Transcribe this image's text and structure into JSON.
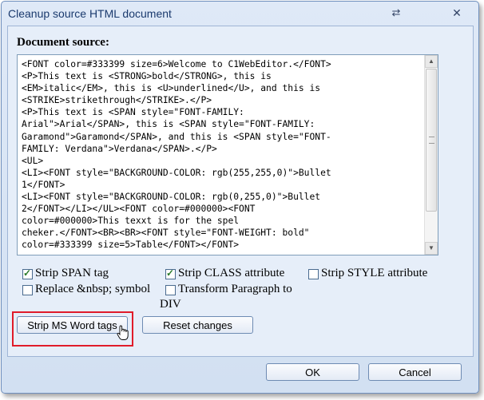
{
  "dialog": {
    "title": "Cleanup source HTML document",
    "pin_icon": "pin-icon",
    "close_icon": "close-icon"
  },
  "source": {
    "label": "Document source:",
    "lines": [
      "<FONT color=#333399 size=6>Welcome to C1WebEditor.</FONT>",
      "<P>This text is <STRONG>bold</STRONG>, this is",
      "<EM>italic</EM>, this is <U>underlined</U>, and this is",
      "<STRIKE>strikethrough</STRIKE>.</P>",
      "<P>This text is <SPAN style=\"FONT-FAMILY:",
      "Arial\">Arial</SPAN>, this is <SPAN style=\"FONT-FAMILY:",
      "Garamond\">Garamond</SPAN>, and this is <SPAN style=\"FONT-",
      "FAMILY: Verdana\">Verdana</SPAN>.</P>",
      "<UL>",
      "<LI><FONT style=\"BACKGROUND-COLOR: rgb(255,255,0)\">Bullet",
      "1</FONT>",
      "<LI><FONT style=\"BACKGROUND-COLOR: rgb(0,255,0)\">Bullet",
      "2</FONT></LI></UL><FONT color=#000000><FONT",
      "color=#000000>This texxt is for the spel",
      "cheker.</FONT><BR><BR><FONT style=\"FONT-WEIGHT: bold\"",
      "color=#333399 size=5>Table</FONT></FONT>"
    ]
  },
  "options": {
    "strip_span": {
      "label": "Strip SPAN tag",
      "checked": true
    },
    "strip_class": {
      "label": "Strip CLASS attribute",
      "checked": true
    },
    "strip_style": {
      "label": "Strip STYLE attribute",
      "checked": false
    },
    "replace_nbsp": {
      "label": "Replace &nbsp; symbol",
      "checked": false
    },
    "transform_para_line1": "Transform Paragraph to",
    "transform_para_line2": "DIV",
    "transform_para_checked": false
  },
  "buttons": {
    "strip_word": "Strip MS Word tags",
    "reset": "Reset changes",
    "ok": "OK",
    "cancel": "Cancel"
  },
  "colors": {
    "accent_highlight": "#e01c2a",
    "title_text": "#1a3a6e"
  }
}
